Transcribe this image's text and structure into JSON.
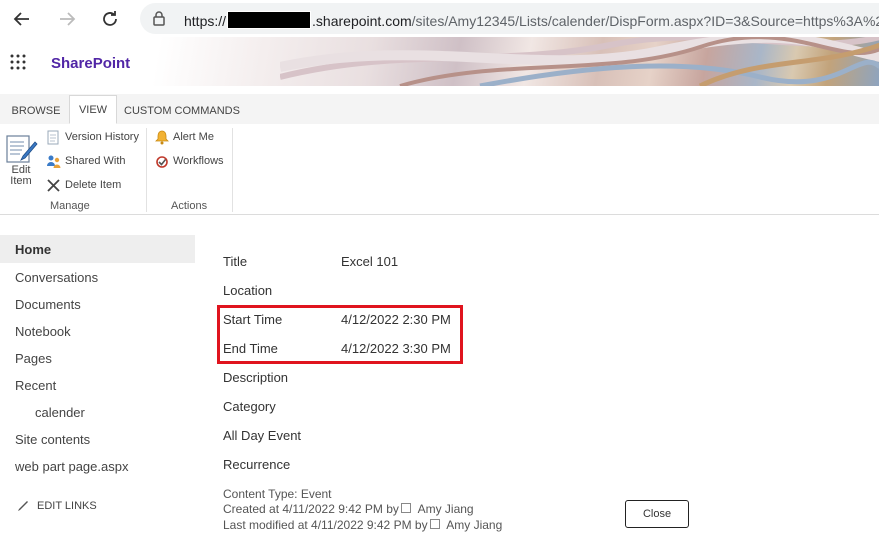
{
  "browser": {
    "url_prefix": "https://",
    "url_host": ".sharepoint.com",
    "url_path": "/sites/Amy12345/Lists/calender/DispForm.aspx?ID=3&Source=https%3A%2"
  },
  "suite": {
    "brand": "SharePoint"
  },
  "ribbon": {
    "tabs": [
      {
        "label": "BROWSE"
      },
      {
        "label": "VIEW"
      },
      {
        "label": "CUSTOM COMMANDS"
      }
    ],
    "manage": {
      "edit_item": "Edit Item",
      "version_history": "Version History",
      "shared_with": "Shared With",
      "delete_item": "Delete Item",
      "group_label": "Manage"
    },
    "actions": {
      "alert_me": "Alert Me",
      "workflows": "Workflows",
      "group_label": "Actions"
    }
  },
  "leftnav": {
    "items": [
      {
        "label": "Home"
      },
      {
        "label": "Conversations"
      },
      {
        "label": "Documents"
      },
      {
        "label": "Notebook"
      },
      {
        "label": "Pages"
      },
      {
        "label": "Recent"
      },
      {
        "label": "calender"
      },
      {
        "label": "Site contents"
      },
      {
        "label": "web part page.aspx"
      }
    ],
    "edit_links": "EDIT LINKS"
  },
  "form": {
    "fields": [
      {
        "label": "Title",
        "value": "Excel 101"
      },
      {
        "label": "Location",
        "value": ""
      },
      {
        "label": "Start Time",
        "value": "4/12/2022 2:30 PM"
      },
      {
        "label": "End Time",
        "value": "4/12/2022 3:30 PM"
      },
      {
        "label": "Description",
        "value": ""
      },
      {
        "label": "Category",
        "value": ""
      },
      {
        "label": "All Day Event",
        "value": ""
      },
      {
        "label": "Recurrence",
        "value": ""
      }
    ],
    "content_type": "Content Type: Event",
    "created_prefix": "Created at 4/11/2022 9:42 PM by",
    "created_by": "Amy Jiang",
    "modified_prefix": "Last modified at 4/11/2022 9:42 PM by",
    "modified_by": "Amy Jiang",
    "close_label": "Close"
  },
  "colors": {
    "brand": "#5126a6",
    "highlight": "#e0141e"
  }
}
